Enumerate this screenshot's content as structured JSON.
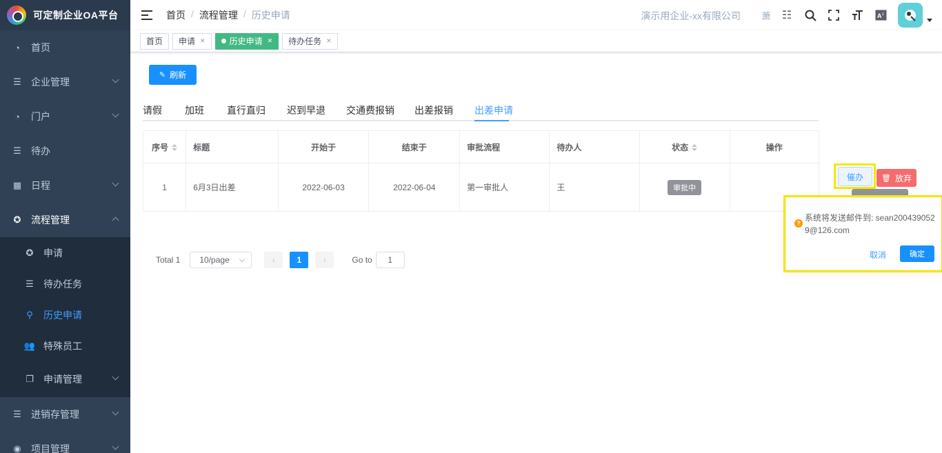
{
  "app": {
    "title": "可定制企业OA平台"
  },
  "sidebar": {
    "items": [
      {
        "label": "首页",
        "icon": "dashboard-icon"
      },
      {
        "label": "企业管理",
        "icon": "tree-table-icon"
      },
      {
        "label": "门户",
        "icon": "dashboard-icon"
      },
      {
        "label": "待办",
        "icon": "list-icon"
      },
      {
        "label": "日程",
        "icon": "grid-icon"
      },
      {
        "label": "流程管理",
        "icon": "lifebuoy-icon"
      },
      {
        "label": "进销存管理",
        "icon": "tree-table-icon"
      },
      {
        "label": "项目管理",
        "icon": "eye-icon"
      }
    ],
    "submenu": [
      {
        "label": "申请",
        "icon": "lifebuoy-icon"
      },
      {
        "label": "待办任务",
        "icon": "list-icon"
      },
      {
        "label": "历史申请",
        "icon": "search-icon"
      },
      {
        "label": "特殊员工",
        "icon": "people-icon"
      },
      {
        "label": "申请管理",
        "icon": "copy-icon"
      }
    ]
  },
  "header": {
    "breadcrumb": [
      "首页",
      "流程管理",
      "历史申请"
    ],
    "company": "演示用企业-xx有限公司",
    "user_short": "萧"
  },
  "tags": [
    {
      "label": "首页"
    },
    {
      "label": "申请"
    },
    {
      "label": "历史申请"
    },
    {
      "label": "待办任务"
    }
  ],
  "toolbar": {
    "refresh_label": "刷新"
  },
  "tabs": [
    "请假",
    "加班",
    "直行直归",
    "迟到早退",
    "交通费报销",
    "出差报销",
    "出差申请"
  ],
  "table": {
    "columns": [
      "序号",
      "标题",
      "开始于",
      "结束于",
      "审批流程",
      "待办人",
      "状态",
      "操作"
    ],
    "rows": [
      {
        "index": "1",
        "title": "6月3日出差",
        "start": "2022-06-03",
        "end": "2022-06-04",
        "flow": "第一审批人",
        "assignee": "王",
        "status": "审批中"
      }
    ],
    "actions": {
      "urge": "催办",
      "abandon": "放弃"
    }
  },
  "pagination": {
    "total": "Total 1",
    "page_size": "10/page",
    "current": "1",
    "goto_label": "Go to",
    "goto_value": "1"
  },
  "popconfirm": {
    "message": "系统将发送邮件到: sean2004390529@126.com",
    "cancel": "取消",
    "confirm": "确定"
  },
  "colors": {
    "primary": "#1890ff",
    "active_tag": "#42b983",
    "danger": "#f56c6c",
    "sidebar": "#304156",
    "highlight": "#f5e800"
  }
}
